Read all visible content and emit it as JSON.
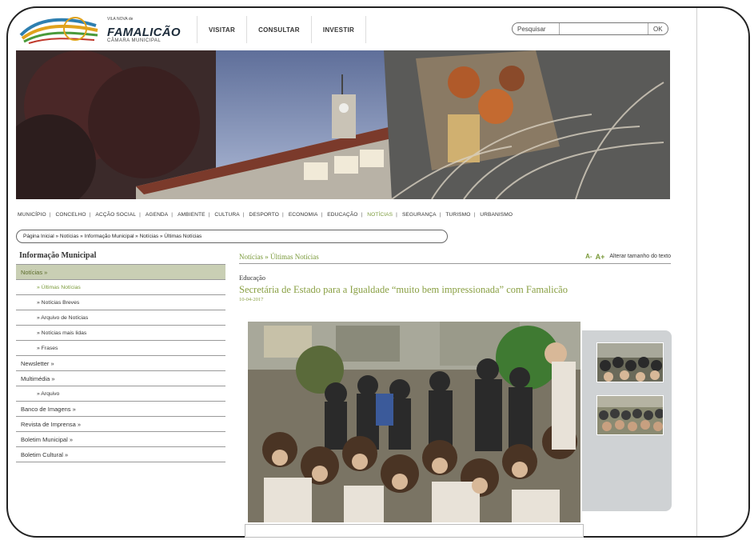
{
  "header": {
    "logo_small_text": "VILA NOVA de",
    "logo_name": "FAMALICÃO",
    "logo_subtitle": "CÂMARA MUNICIPAL",
    "tabs": [
      {
        "label": "VISITAR"
      },
      {
        "label": "CONSULTAR"
      },
      {
        "label": "INVESTIR"
      }
    ],
    "search": {
      "label": "Pesquisar",
      "value": "",
      "button": "OK"
    }
  },
  "main_nav": [
    {
      "label": "MUNICÍPIO",
      "active": false
    },
    {
      "label": "CONCELHO",
      "active": false
    },
    {
      "label": "ACÇÃO SOCIAL",
      "active": false
    },
    {
      "label": "AGENDA",
      "active": false
    },
    {
      "label": "AMBIENTE",
      "active": false
    },
    {
      "label": "CULTURA",
      "active": false
    },
    {
      "label": "DESPORTO",
      "active": false
    },
    {
      "label": "ECONOMIA",
      "active": false
    },
    {
      "label": "EDUCAÇÃO",
      "active": false
    },
    {
      "label": "NOTÍCIAS",
      "active": true
    },
    {
      "label": "SEGURANÇA",
      "active": false
    },
    {
      "label": "TURISMO",
      "active": false
    },
    {
      "label": "URBANISMO",
      "active": false
    }
  ],
  "breadcrumb": "Página Inicial » Notícias » Informação Municipal » Notícias » Últimas Notícias",
  "sidebar": {
    "title": "Informação Municipal",
    "items": [
      {
        "label": "Notícias »",
        "type": "main",
        "active": true
      },
      {
        "label": "» Últimas Notícias",
        "type": "sub",
        "active": true
      },
      {
        "label": "» Notícias Breves",
        "type": "sub",
        "active": false
      },
      {
        "label": "» Arquivo de Notícias",
        "type": "sub",
        "active": false
      },
      {
        "label": "» Notícias mais lidas",
        "type": "sub",
        "active": false
      },
      {
        "label": "» Frases",
        "type": "sub",
        "active": false
      },
      {
        "label": "Newsletter »",
        "type": "main",
        "active": false
      },
      {
        "label": "Multimédia »",
        "type": "main",
        "active": false
      },
      {
        "label": "» Arquivo",
        "type": "sub",
        "active": false
      },
      {
        "label": "Banco de Imagens »",
        "type": "main",
        "active": false
      },
      {
        "label": "Revista de Imprensa »",
        "type": "main",
        "active": false
      },
      {
        "label": "Boletim Municipal »",
        "type": "main",
        "active": false
      },
      {
        "label": "Boletim Cultural »",
        "type": "main",
        "active": false
      }
    ]
  },
  "content": {
    "section_crumb": "Notícias » Últimas Notícias",
    "font_decrease": "A-",
    "font_increase": "A+",
    "font_label": "Alterar tamanho do texto",
    "category": "Educação",
    "headline": "Secretária de Estado para a Igualdade “muito bem impressionada” com Famalicão",
    "date": "10-04-2017"
  },
  "colors": {
    "accent_green": "#8aa044",
    "active_sidebar_bg": "#c9cfb4",
    "photo_panel_bg": "#cfd2d4"
  }
}
